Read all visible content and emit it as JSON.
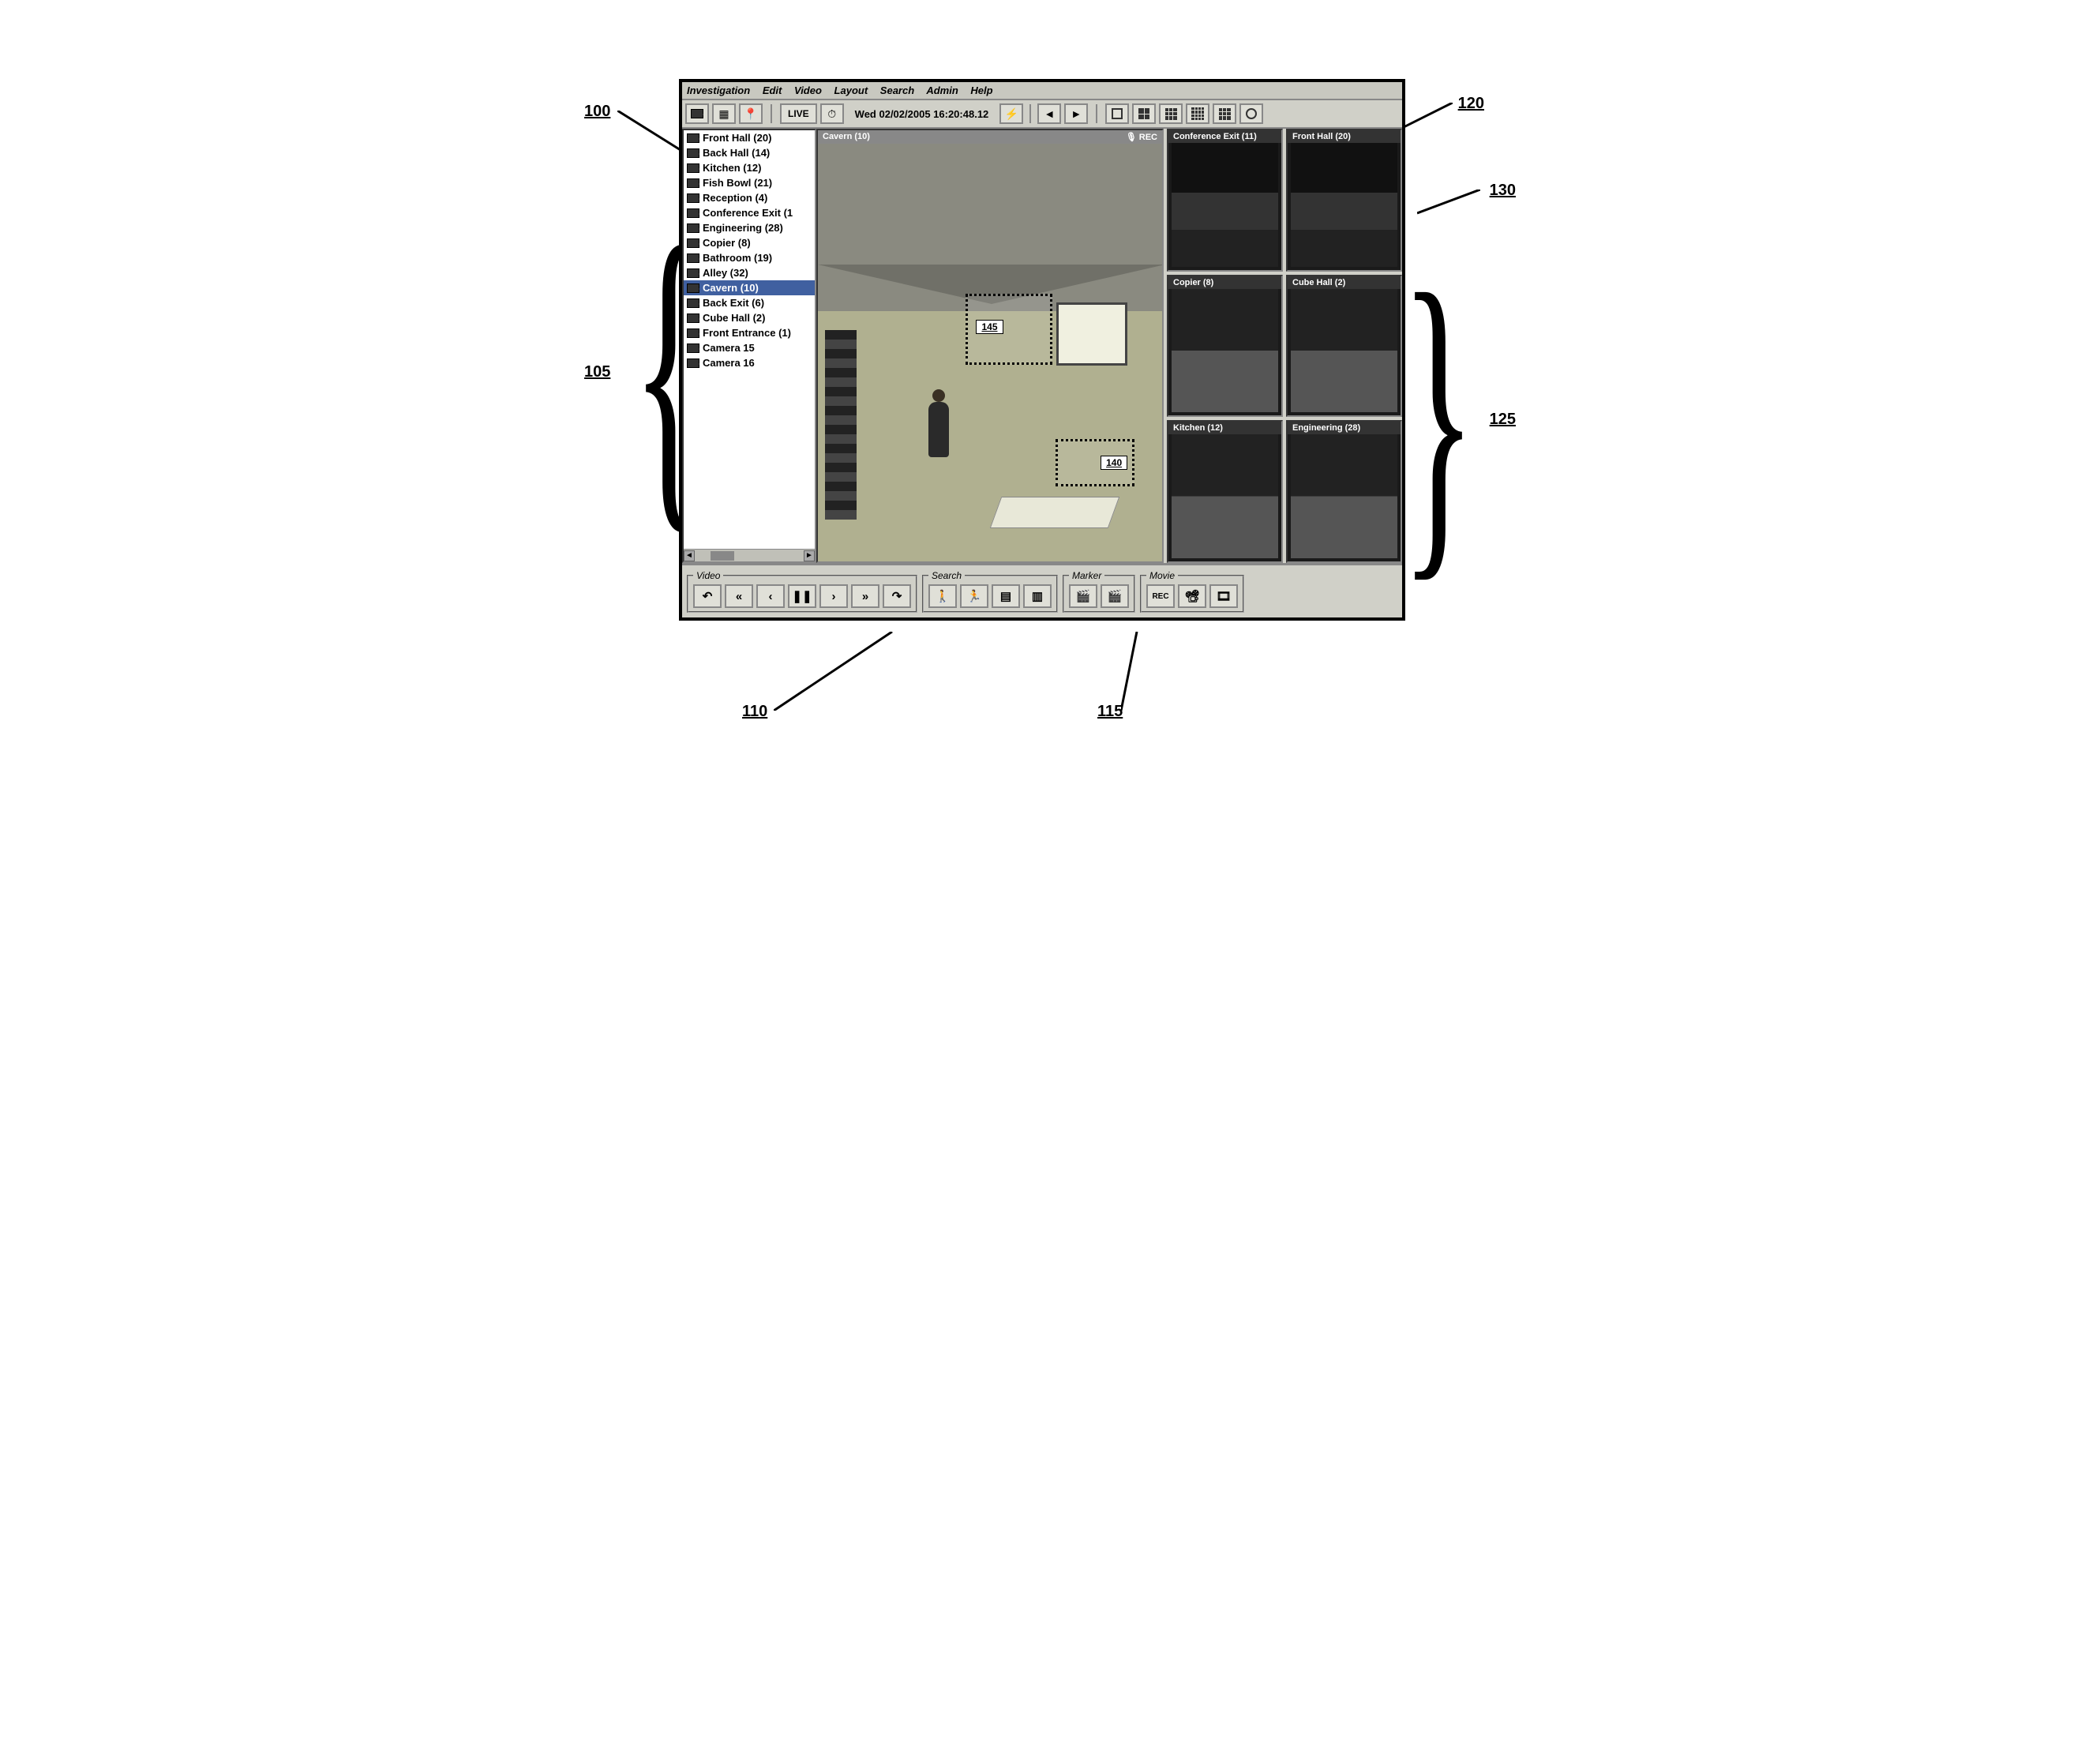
{
  "callouts": {
    "c100": "100",
    "c105": "105",
    "c110": "110",
    "c115": "115",
    "c120": "120",
    "c125": "125",
    "c130": "130",
    "c140": "140",
    "c145": "145"
  },
  "menu": {
    "investigation": "Investigation",
    "edit": "Edit",
    "video": "Video",
    "layout": "Layout",
    "search": "Search",
    "admin": "Admin",
    "help": "Help"
  },
  "toolbar": {
    "live": "LIVE",
    "timestamp": "Wed 02/02/2005 16:20:48.12"
  },
  "cameras": [
    {
      "label": "Front Hall (20)"
    },
    {
      "label": "Back Hall (14)"
    },
    {
      "label": "Kitchen (12)"
    },
    {
      "label": "Fish Bowl (21)"
    },
    {
      "label": "Reception (4)"
    },
    {
      "label": "Conference Exit (1"
    },
    {
      "label": "Engineering (28)"
    },
    {
      "label": "Copier (8)"
    },
    {
      "label": "Bathroom (19)"
    },
    {
      "label": "Alley (32)"
    },
    {
      "label": "Cavern (10)",
      "selected": true
    },
    {
      "label": "Back Exit (6)"
    },
    {
      "label": "Cube Hall (2)"
    },
    {
      "label": "Front Entrance (1)"
    },
    {
      "label": "Camera 15"
    },
    {
      "label": "Camera 16"
    }
  ],
  "main_pane": {
    "title": "Cavern (10)"
  },
  "thumbs": [
    {
      "title": "Conference Exit (11)"
    },
    {
      "title": "Front Hall (20)"
    },
    {
      "title": "Copier (8)"
    },
    {
      "title": "Cube Hall (2)"
    },
    {
      "title": "Kitchen (12)"
    },
    {
      "title": "Engineering (28)"
    }
  ],
  "bottom": {
    "video_legend": "Video",
    "search_legend": "Search",
    "marker_legend": "Marker",
    "movie_legend": "Movie",
    "rec": "REC"
  }
}
